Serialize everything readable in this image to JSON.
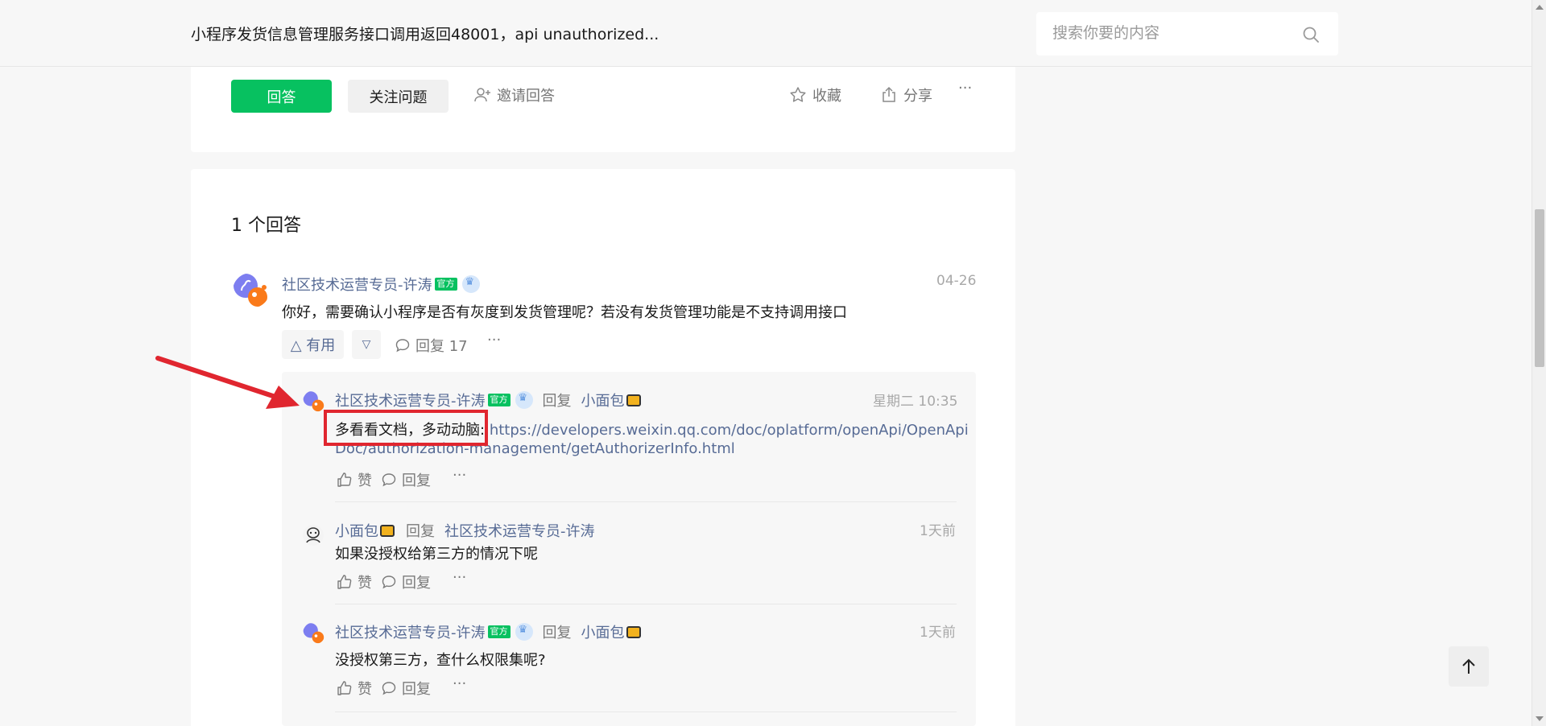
{
  "header": {
    "title": "小程序发货信息管理服务接口调用返回48001，api unauthorized...",
    "search_placeholder": "搜索你要的内容",
    "search_icon": "search-icon"
  },
  "actions": {
    "answer": "回答",
    "follow": "关注问题",
    "invite": "邀请回答",
    "collect": "收藏",
    "share": "分享",
    "more": "···"
  },
  "answers": {
    "count_label": "1 个回答",
    "items": [
      {
        "author": "社区技术运营专员-许涛",
        "official_badge": "官方",
        "time": "04-26",
        "content": "你好，需要确认小程序是否有灰度到发货管理呢？若没有发货管理功能是不支持调用接口",
        "useful_label": "△ 有用",
        "downvote_label": "▽",
        "reply_label": "回复 17",
        "more": "···",
        "replies": [
          {
            "author": "社区技术运营专员-许涛",
            "official_badge": "官方",
            "reply_word": "回复",
            "target": "小面包",
            "time": "星期二 10:35",
            "text": "多看看文档，多动动脑:",
            "link_line1": "https://developers.weixin.qq.com/doc/oplatform/openApi/OpenApi",
            "link_line2": "Doc/authorization-management/getAuthorizerInfo.html",
            "like": "赞",
            "reply": "回复",
            "more": "···"
          },
          {
            "author": "小面包",
            "reply_word": "回复",
            "target": "社区技术运营专员-许涛",
            "time": "1天前",
            "text": "如果没授权给第三方的情况下呢",
            "like": "赞",
            "reply": "回复",
            "more": "···"
          },
          {
            "author": "社区技术运营专员-许涛",
            "official_badge": "官方",
            "reply_word": "回复",
            "target": "小面包",
            "time": "1天前",
            "text": "没授权第三方，查什么权限集呢?",
            "like": "赞",
            "reply": "回复",
            "more": "···"
          }
        ]
      }
    ]
  },
  "colors": {
    "brand_green": "#07c160",
    "link_blue": "#576b95",
    "annotation_red": "#e0262f"
  }
}
